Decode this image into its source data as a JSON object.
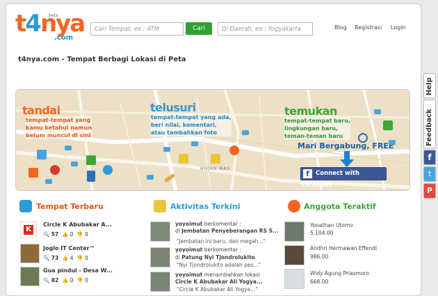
{
  "header": {
    "logo_text_t": "t",
    "logo_text_4": "4",
    "logo_text_nya": "nya",
    "logo_dotcom": ".com",
    "logo_beta": "beta",
    "search_place_placeholder": "Cari Tempat, ex : ATM",
    "search_button": "Cari",
    "search_area_placeholder": "Di Daerah, ex : Yogyakarta",
    "nav": [
      "Blog",
      "Registrasi",
      "Login"
    ]
  },
  "tagline": "t4nya.com - Tempat Berbagi Lokasi di Peta",
  "banner": {
    "tandai": {
      "title": "tandai",
      "text": [
        "tempat-tempat yang",
        "kamu ketahui namun",
        "belum muncul di sini"
      ]
    },
    "telusuri": {
      "title": "telusuri",
      "text": [
        "tempat-tempat yang ada,",
        "beri nilai, komentari,",
        "atau tambahkan foto"
      ]
    },
    "temukan": {
      "title": "temukan",
      "text": [
        "tempat-tempat baru,",
        "lingkungan baru,",
        "teman-teman baru"
      ]
    },
    "join": "Mari Bergabung, FREE",
    "facebook_btn": "Connect with Facebook",
    "map_label": "HUJAN MAS"
  },
  "sections": {
    "tempat": {
      "title": "Tempat Terbaru",
      "items": [
        {
          "name": "Circle K Abubakar A...",
          "views": "57",
          "likes": "0",
          "dislikes": "0"
        },
        {
          "name": "Joglo IT Center™",
          "views": "73",
          "likes": "4",
          "dislikes": "0"
        },
        {
          "name": "Gua pindul - Desa W...",
          "views": "82",
          "likes": "0",
          "dislikes": "0"
        }
      ]
    },
    "aktivitas": {
      "title": "Aktivitas Terkini",
      "items": [
        {
          "user": "yoyoimut",
          "action": "berkomentar :",
          "at": "di",
          "place": "Jembatan Penyeberangan RS S...",
          "quote": "\"Jembatan ini baru, dan megah...\""
        },
        {
          "user": "yoyoimut",
          "action": "berkomentar :",
          "at": "di",
          "place": "Patung Nyi Tjondrolukito",
          "quote": "\"Nyi Tjondrolukito adalah pes...\""
        },
        {
          "user": "yoyoimut",
          "action": "menambahkan lokasi",
          "at": "",
          "place": "Circle K Abubakar Ali Yogya...",
          "quote": "\"Circle K Abubakar Ali Yogya...\""
        }
      ]
    },
    "anggota": {
      "title": "Anggota Teraktif",
      "items": [
        {
          "name": "Yonathan Utomo",
          "points": "5,104.00"
        },
        {
          "name": "Andhri Hermawan Effendi",
          "points": "986.00"
        },
        {
          "name": "Widy Agung Priasmoro",
          "points": "668.00"
        }
      ]
    }
  },
  "sidetab": {
    "help": "Help",
    "feedback": "Feedback"
  },
  "colors": {
    "orange": "#f26522",
    "blue": "#2e9ad7",
    "green": "#3aa935",
    "fb": "#3b5998"
  }
}
